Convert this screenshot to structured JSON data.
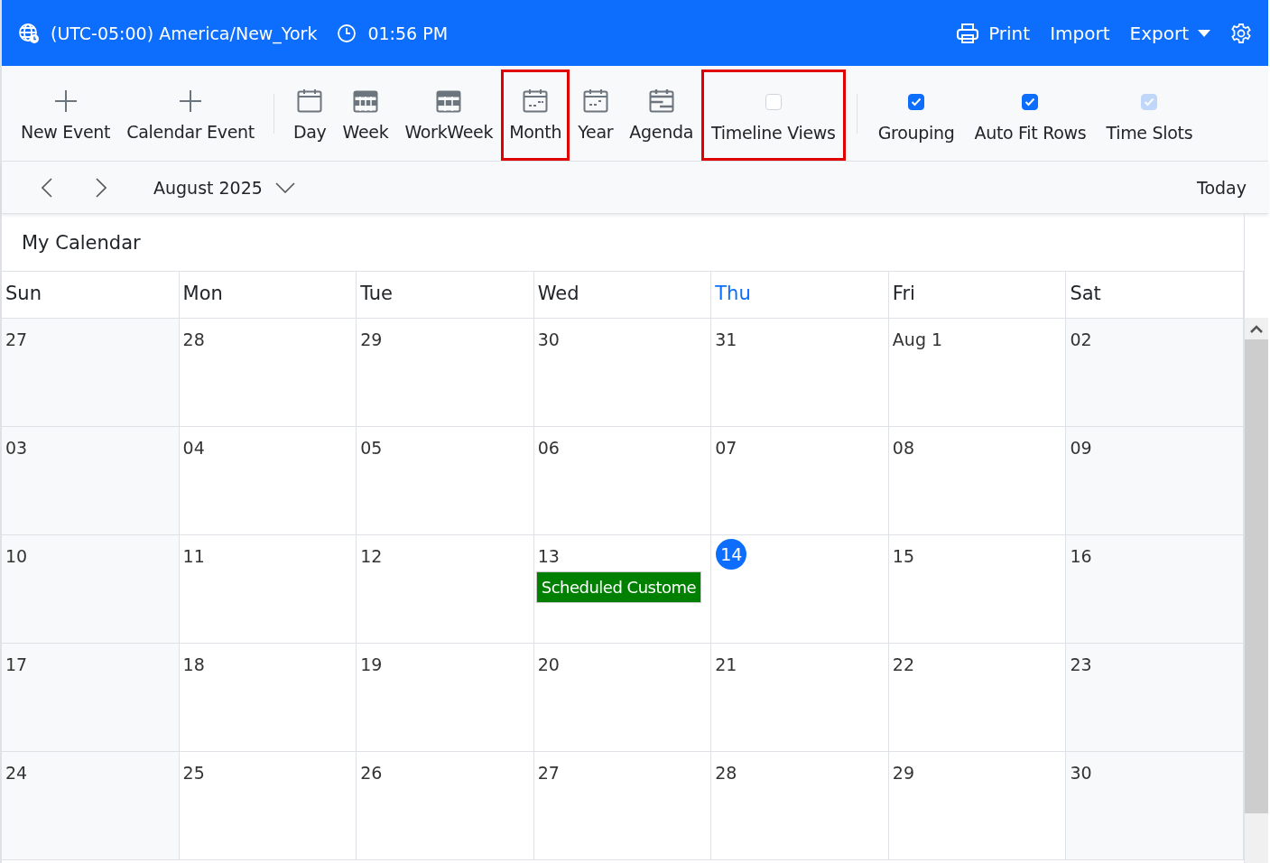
{
  "header": {
    "timezone": "(UTC-05:00) America/New_York",
    "time": "01:56 PM",
    "actions": [
      {
        "label": "Print",
        "kind": "print"
      },
      {
        "label": "Import",
        "kind": "plain"
      },
      {
        "label": "Export",
        "kind": "dropdown"
      }
    ]
  },
  "toolbar": {
    "groups": [
      [
        {
          "kind": "add",
          "label": "New Event"
        },
        {
          "kind": "add",
          "label": "Calendar Event"
        }
      ],
      [
        {
          "kind": "view",
          "label": "Day",
          "highlighted": false
        },
        {
          "kind": "view",
          "label": "Week",
          "highlighted": false
        },
        {
          "kind": "view",
          "label": "WorkWeek",
          "highlighted": false
        },
        {
          "kind": "view",
          "label": "Month",
          "highlighted": true
        },
        {
          "kind": "view",
          "label": "Year",
          "highlighted": false
        },
        {
          "kind": "view",
          "label": "Agenda",
          "highlighted": false
        },
        {
          "kind": "toggle",
          "label": "Timeline Views",
          "checked": false,
          "disabled": false,
          "highlighted": true
        }
      ],
      [
        {
          "kind": "toggle",
          "label": "Grouping",
          "checked": true,
          "disabled": false,
          "highlighted": false
        },
        {
          "kind": "toggle",
          "label": "Auto Fit Rows",
          "checked": true,
          "disabled": false,
          "highlighted": false
        },
        {
          "kind": "toggle",
          "label": "Time Slots",
          "checked": true,
          "disabled": true,
          "highlighted": false
        }
      ]
    ]
  },
  "navigation": {
    "period": "August 2025",
    "today": "Today"
  },
  "calendar": {
    "title": "My Calendar",
    "days": [
      {
        "label": "Sun",
        "current": false
      },
      {
        "label": "Mon",
        "current": false
      },
      {
        "label": "Tue",
        "current": false
      },
      {
        "label": "Wed",
        "current": false
      },
      {
        "label": "Thu",
        "current": true
      },
      {
        "label": "Fri",
        "current": false
      },
      {
        "label": "Sat",
        "current": false
      }
    ],
    "weeks": [
      [
        {
          "date": "27"
        },
        {
          "date": "28"
        },
        {
          "date": "29"
        },
        {
          "date": "30"
        },
        {
          "date": "31"
        },
        {
          "date": "Aug 1"
        },
        {
          "date": "02"
        }
      ],
      [
        {
          "date": "03"
        },
        {
          "date": "04"
        },
        {
          "date": "05"
        },
        {
          "date": "06"
        },
        {
          "date": "07"
        },
        {
          "date": "08"
        },
        {
          "date": "09"
        }
      ],
      [
        {
          "date": "10"
        },
        {
          "date": "11"
        },
        {
          "date": "12"
        },
        {
          "date": "13",
          "events": [
            {
              "title": "Scheduled Custome",
              "color": "#008000"
            }
          ]
        },
        {
          "date": "14",
          "today": true
        },
        {
          "date": "15"
        },
        {
          "date": "16"
        }
      ],
      [
        {
          "date": "17"
        },
        {
          "date": "18"
        },
        {
          "date": "19"
        },
        {
          "date": "20"
        },
        {
          "date": "21"
        },
        {
          "date": "22"
        },
        {
          "date": "23"
        }
      ],
      [
        {
          "date": "24"
        },
        {
          "date": "25"
        },
        {
          "date": "26"
        },
        {
          "date": "27"
        },
        {
          "date": "28"
        },
        {
          "date": "29"
        },
        {
          "date": "30"
        }
      ]
    ]
  }
}
